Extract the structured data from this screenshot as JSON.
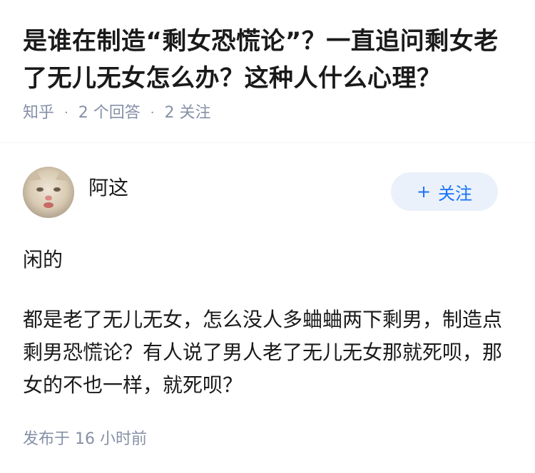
{
  "question": {
    "title": "是谁在制造“剩女恐慌论”？一直追问剩女老了无儿无女怎么办？这种人什么心理？",
    "source": "知乎",
    "answers_count": "2 个回答",
    "followers_count": "2 关注"
  },
  "answer": {
    "author": "阿这",
    "follow_label": "关注",
    "paragraphs": [
      "闲的",
      "都是老了无儿无女，怎么没人多蛐蛐两下剩男，制造点剩男恐慌论？有人说了男人老了无儿无女那就死呗，那女的不也一样，就死呗？"
    ],
    "published": "发布于  16 小时前"
  }
}
